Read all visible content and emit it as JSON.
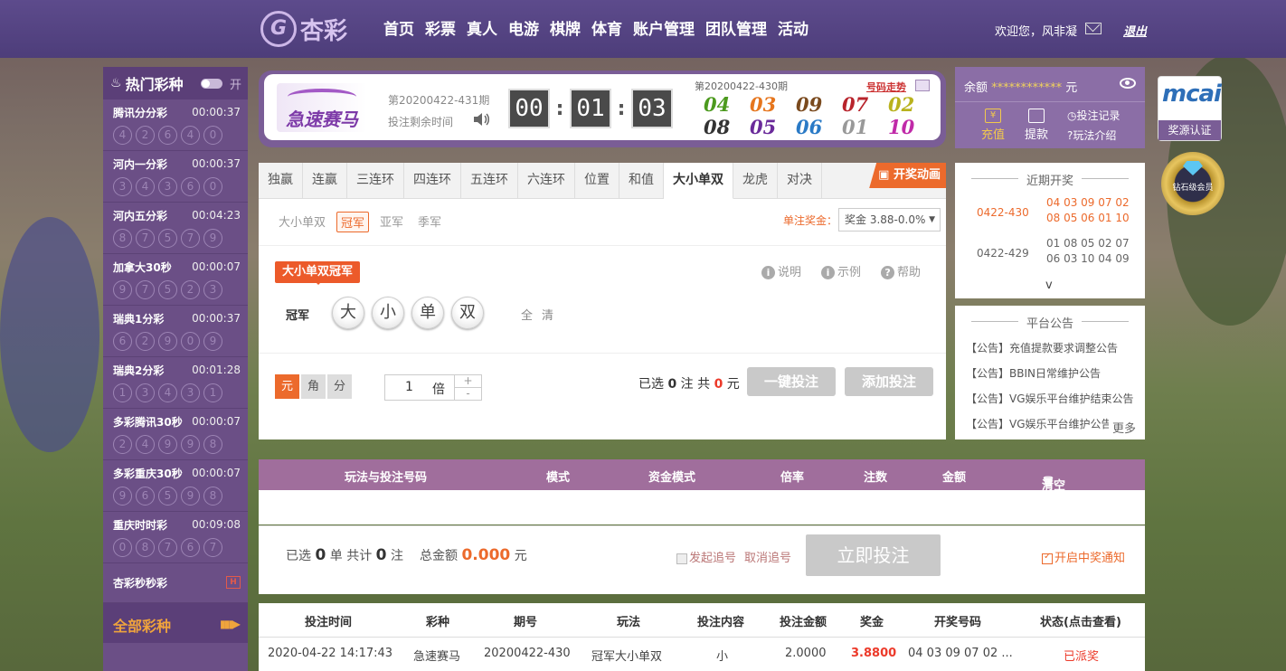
{
  "top": {
    "logo_text": "杏彩",
    "nav": [
      "首页",
      "彩票",
      "真人",
      "电游",
      "棋牌",
      "体育",
      "账户管理",
      "团队管理",
      "活动"
    ],
    "welcome": "欢迎您，风非凝",
    "logout": "退出"
  },
  "sidebar": {
    "title": "热门彩种",
    "toggle_label": "开",
    "lotteries": [
      {
        "name": "腾讯分分彩",
        "time": "00:00:37",
        "balls": [
          "4",
          "2",
          "6",
          "4",
          "0"
        ]
      },
      {
        "name": "河内一分彩",
        "time": "00:00:37",
        "balls": [
          "3",
          "4",
          "3",
          "6",
          "0"
        ]
      },
      {
        "name": "河内五分彩",
        "time": "00:04:23",
        "balls": [
          "8",
          "7",
          "5",
          "7",
          "9"
        ]
      },
      {
        "name": "加拿大30秒",
        "time": "00:00:07",
        "balls": [
          "9",
          "7",
          "5",
          "2",
          "3"
        ]
      },
      {
        "name": "瑞典1分彩",
        "time": "00:00:37",
        "balls": [
          "6",
          "2",
          "9",
          "0",
          "9"
        ]
      },
      {
        "name": "瑞典2分彩",
        "time": "00:01:28",
        "balls": [
          "1",
          "3",
          "4",
          "3",
          "1"
        ]
      },
      {
        "name": "多彩腾讯30秒",
        "time": "00:00:07",
        "balls": [
          "2",
          "4",
          "9",
          "9",
          "8"
        ]
      },
      {
        "name": "多彩重庆30秒",
        "time": "00:00:07",
        "balls": [
          "9",
          "6",
          "5",
          "9",
          "8"
        ]
      },
      {
        "name": "重庆时时彩",
        "time": "00:09:08",
        "balls": [
          "0",
          "8",
          "7",
          "6",
          "7"
        ]
      }
    ],
    "single": "杏彩秒秒彩",
    "single_badge": "H",
    "all": "全部彩种"
  },
  "game": {
    "logo_text": "急速赛马",
    "period": "第20200422-431期",
    "remain_label": "投注剩余时间",
    "timer": [
      "00",
      "01",
      "03"
    ],
    "last_period": "第20200422-430期",
    "trend_label": "号码走势",
    "last_numbers": [
      {
        "n": "04",
        "c": "#4c9a1e"
      },
      {
        "n": "03",
        "c": "#e6761e"
      },
      {
        "n": "09",
        "c": "#7a4a1e"
      },
      {
        "n": "07",
        "c": "#b8242c"
      },
      {
        "n": "02",
        "c": "#b9b21e"
      },
      {
        "n": "08",
        "c": "#333333"
      },
      {
        "n": "05",
        "c": "#6a2a9a"
      },
      {
        "n": "06",
        "c": "#2a7ac6"
      },
      {
        "n": "01",
        "c": "#999999"
      },
      {
        "n": "10",
        "c": "#c02aa8"
      }
    ]
  },
  "account": {
    "balance_label": "余额",
    "balance_value": "************",
    "unit": "元",
    "charge": "充值",
    "withdraw": "提款",
    "bet_record": "投注记录",
    "play_intro": "玩法介绍",
    "cert_logo": "mcai",
    "cert_label": "奖源认证",
    "vip_label": "钻石级会员"
  },
  "recent": {
    "title": "近期开奖",
    "rows": [
      {
        "period": "0422-430",
        "nums": "04 03 09 07 02 08 05 06 01 10"
      },
      {
        "period": "0422-429",
        "nums": "01 08 05 02 07 06 03 10 04 09"
      }
    ],
    "chevron": "v"
  },
  "notice": {
    "title": "平台公告",
    "items": [
      "【公告】充值提款要求调整公告",
      "【公告】BBIN日常维护公告",
      "【公告】VG娱乐平台维护结束公告",
      "【公告】VG娱乐平台维护公告"
    ],
    "more": "更多"
  },
  "bet": {
    "tabs": [
      "独赢",
      "连赢",
      "三连环",
      "四连环",
      "五连环",
      "六连环",
      "位置",
      "和值",
      "大小单双",
      "龙虎",
      "对决"
    ],
    "active_tab": "大小单双",
    "anim_label": "开奖动画",
    "subtabs": [
      "大小单双",
      "冠军",
      "亚军",
      "季军"
    ],
    "prize_label": "单注奖金：",
    "prize_value": "奖金 3.88-0.0%",
    "pill": "大小单双冠军",
    "helps": [
      "说明",
      "示例",
      "帮助"
    ],
    "row_label": "冠军",
    "balls": [
      "大",
      "小",
      "单",
      "双"
    ],
    "all_clear": "全清",
    "units": [
      "元",
      "角",
      "分"
    ],
    "multiplier": "1",
    "multiplier_unit": "倍",
    "plus": "+",
    "minus": "-",
    "sel_prefix": "已选",
    "sel_count": "0",
    "sel_mid": "注  共",
    "sel_amount": "0",
    "sel_unit": "元",
    "quick_bet": "一键投注",
    "add_bet": "添加投注"
  },
  "order": {
    "headers": [
      "玩法与投注号码",
      "模式",
      "资金模式",
      "倍率",
      "注数",
      "金额",
      "清空"
    ],
    "sel_prefix": "已选",
    "sel_count": "0",
    "sel_unit": "单 共计",
    "bet_count": "0",
    "bet_unit": "注",
    "total_label": "总金额",
    "total": "0.000",
    "total_unit": "元",
    "chase": "发起追号",
    "cancel_chase": "取消追号",
    "bet_now": "立即投注",
    "notify": "开启中奖通知"
  },
  "history": {
    "headers": [
      "投注时间",
      "彩种",
      "期号",
      "玩法",
      "投注内容",
      "投注金额",
      "奖金",
      "开奖号码",
      "状态(点击查看)"
    ],
    "row": [
      "2020-04-22 14:17:43",
      "急速赛马",
      "20200422-430",
      "冠军大小单双",
      "小",
      "2.0000",
      "3.8800",
      "04 03 09 07 02 ...",
      "已派奖"
    ]
  }
}
